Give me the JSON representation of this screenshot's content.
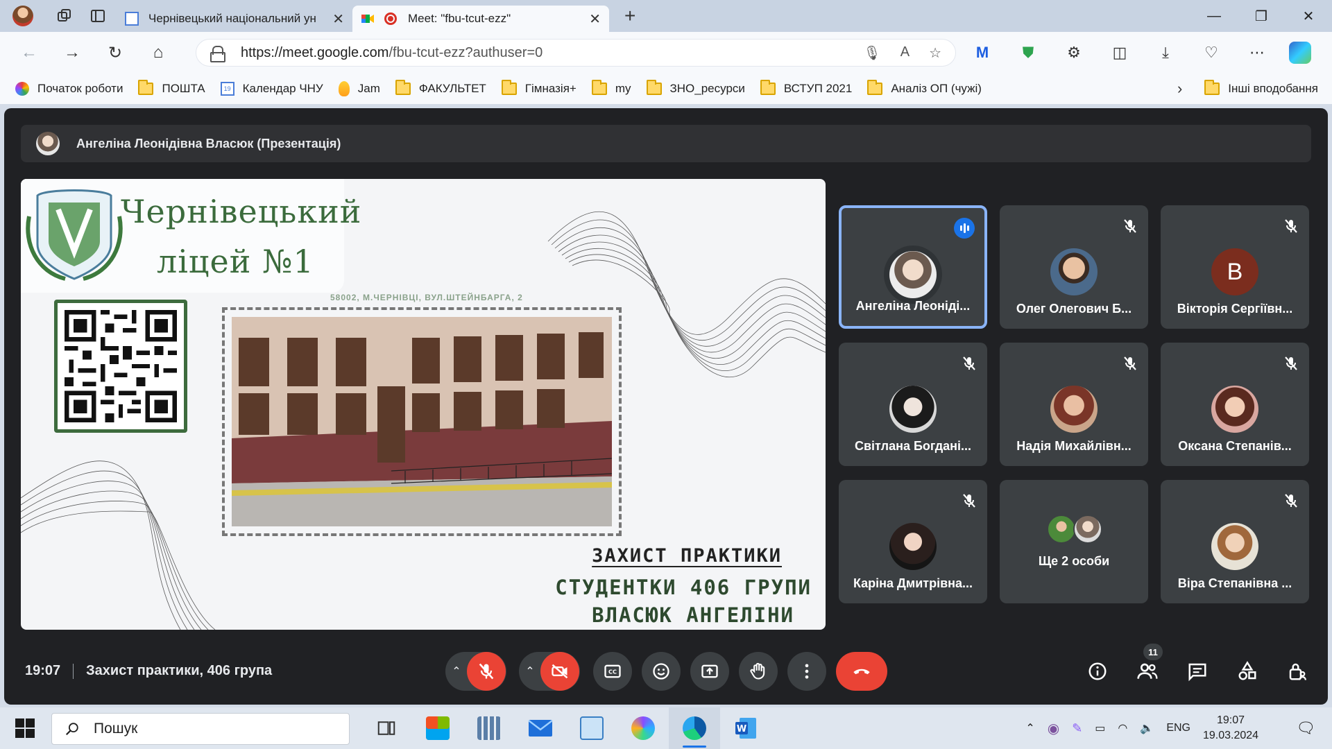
{
  "browser": {
    "tabs": [
      {
        "title": "Чернівецький національний ун",
        "active": false
      },
      {
        "title": "Meet: \"fbu-tcut-ezz\"",
        "active": true
      }
    ],
    "url_host": "https://meet.google.com",
    "url_path": "/fbu-tcut-ezz?authuser=0",
    "bookmarks": [
      {
        "label": "Початок роботи",
        "icon": "browser-start-icon"
      },
      {
        "label": "ПОШТА",
        "icon": "folder-icon"
      },
      {
        "label": "Календар ЧНУ",
        "icon": "calendar-icon"
      },
      {
        "label": "Jam",
        "icon": "jam-icon"
      },
      {
        "label": "ФАКУЛЬТЕТ",
        "icon": "folder-icon"
      },
      {
        "label": "Гімназія+",
        "icon": "folder-icon"
      },
      {
        "label": "my",
        "icon": "folder-icon"
      },
      {
        "label": "ЗНО_ресурси",
        "icon": "folder-icon"
      },
      {
        "label": "ВСТУП 2021",
        "icon": "folder-icon"
      },
      {
        "label": "Аналіз ОП (чужі)",
        "icon": "folder-icon"
      }
    ],
    "other_bookmarks": "Інші вподобання",
    "calendar_day": "19"
  },
  "meet": {
    "presenter": "Ангеліна Леонідівна Власюк (Презентація)",
    "slide": {
      "school_line1": "Чернівецький",
      "school_line2": "ліцей №1",
      "address": "58002, М.ЧЕРНІВЦІ, ВУЛ.ШТЕЙНБАРГА, 2",
      "title_line1": "ЗАХИСТ ПРАКТИКИ",
      "title_line2": "СТУДЕНТКИ 406 ГРУПИ",
      "title_line3": "ВЛАСЮК АНГЕЛІНИ"
    },
    "participants": [
      {
        "name": "Ангеліна Леоніді...",
        "speaking": true,
        "muted": false
      },
      {
        "name": "Олег Олегович Б...",
        "muted": true
      },
      {
        "name": "Вікторія Сергіївн...",
        "muted": true,
        "initial": "В"
      },
      {
        "name": "Світлана Богдані...",
        "muted": true
      },
      {
        "name": "Надія Михайлівн...",
        "muted": true
      },
      {
        "name": "Оксана Степанів...",
        "muted": true
      },
      {
        "name": "Каріна Дмитрівна...",
        "muted": true
      },
      {
        "name": "Ще 2 особи",
        "muted": false
      },
      {
        "name": "Віра Степанівна ...",
        "muted": true
      }
    ],
    "time": "19:07",
    "meeting_title": "Захист практики, 406 група",
    "participant_count": "11",
    "accent_red": "#ea4335",
    "accent_blue": "#8ab4f8"
  },
  "taskbar": {
    "search_placeholder": "Пошук",
    "lang": "ENG",
    "time": "19:07",
    "date": "19.03.2024"
  }
}
